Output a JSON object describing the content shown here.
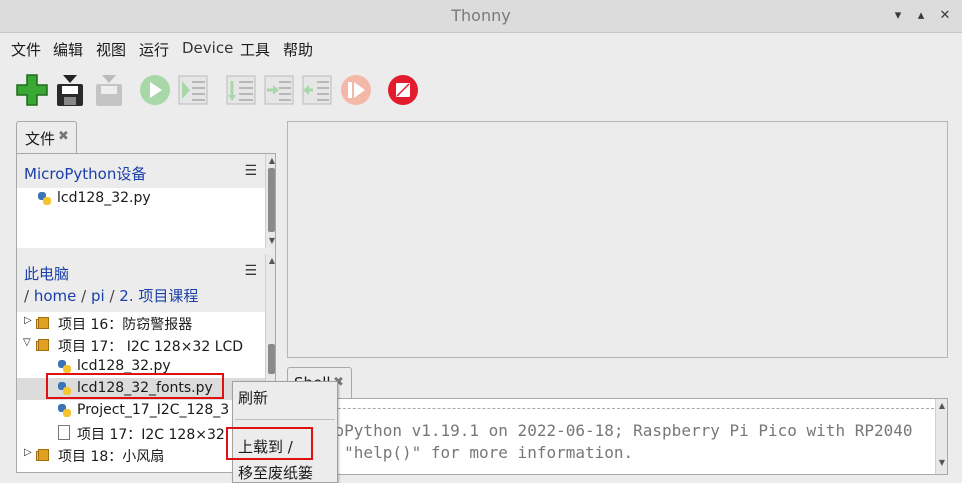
{
  "window": {
    "title": "Thonny"
  },
  "menubar": [
    "文件",
    "编辑",
    "视图",
    "运行",
    "Device",
    "工具",
    "帮助"
  ],
  "toolbar": [
    {
      "name": "new-file-icon",
      "enabled": true
    },
    {
      "name": "save-icon",
      "enabled": true
    },
    {
      "name": "upload-icon",
      "enabled": false
    },
    {
      "name": "run-icon",
      "enabled": false
    },
    {
      "name": "debug-icon",
      "enabled": false
    },
    {
      "name": "step-over-icon",
      "enabled": false
    },
    {
      "name": "step-into-icon",
      "enabled": false
    },
    {
      "name": "step-out-icon",
      "enabled": false
    },
    {
      "name": "resume-icon",
      "enabled": false
    },
    {
      "name": "stop-icon",
      "enabled": true
    }
  ],
  "files": {
    "tab_label": "文件",
    "device": {
      "title": "MicroPython设备",
      "items": [
        "lcd128_32.py"
      ]
    },
    "local": {
      "title": "此电脑",
      "path": [
        "home",
        "pi",
        "2. 项目课程"
      ],
      "items": [
        {
          "label": "项目 16：防窃警报器",
          "type": "folder",
          "expanded": false,
          "indent": 0
        },
        {
          "label": "项目 17： I2C 128×32 LCD",
          "type": "folder",
          "expanded": true,
          "indent": 0
        },
        {
          "label": "lcd128_32.py",
          "type": "py",
          "indent": 1
        },
        {
          "label": "lcd128_32_fonts.py",
          "type": "py",
          "indent": 1
        },
        {
          "label": "Project_17_I2C_128_3",
          "type": "py",
          "indent": 1
        },
        {
          "label": "项目 17：I2C 128×32",
          "type": "doc",
          "indent": 1
        },
        {
          "label": "项目 18：小风扇",
          "type": "folder",
          "expanded": false,
          "indent": 0
        }
      ]
    }
  },
  "shell": {
    "tab_label": "Shell",
    "lines": [
      "MicroPython v1.19.1 on 2022-06-18; Raspberry Pi Pico with RP2040",
      "Type \"help()\" for more information."
    ]
  },
  "context_menu": {
    "items": [
      "刷新",
      "上载到 /",
      "移至废纸篓"
    ]
  },
  "colors": {
    "accent": "#1a3fa8",
    "highlight": "#e01010"
  }
}
